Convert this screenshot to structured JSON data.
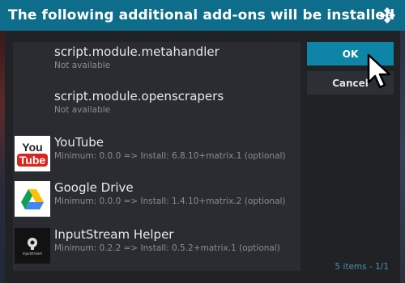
{
  "dialog": {
    "title": "The following additional add-ons will be installed",
    "items": [
      {
        "name": "script.module.metahandler",
        "detail": "Not available",
        "icon": "none"
      },
      {
        "name": "script.module.openscrapers",
        "detail": "Not available",
        "icon": "none"
      },
      {
        "name": "YouTube",
        "detail": "Minimum: 0.0.0 => Install: 6.8.10+matrix.1 (optional)",
        "icon": "youtube-icon",
        "logo_top": "You",
        "logo_bottom": "Tube"
      },
      {
        "name": "Google Drive",
        "detail": "Minimum: 0.0.0 => Install: 1.4.10+matrix.2 (optional)",
        "icon": "google-drive-icon"
      },
      {
        "name": "InputStream Helper",
        "detail": "Minimum: 0.2.2 => Install: 0.5.2+matrix.1 (optional)",
        "icon": "inputstream-helper-icon",
        "logo_text": "inputstream"
      }
    ],
    "ok_label": "OK",
    "cancel_label": "Cancel",
    "item_count": "5 items - 1/1"
  },
  "colors": {
    "titlebar": "#0d6d8a",
    "ok_button": "#0e84a6",
    "youtube_red": "#d8261f",
    "count_text": "#4a90b0"
  }
}
